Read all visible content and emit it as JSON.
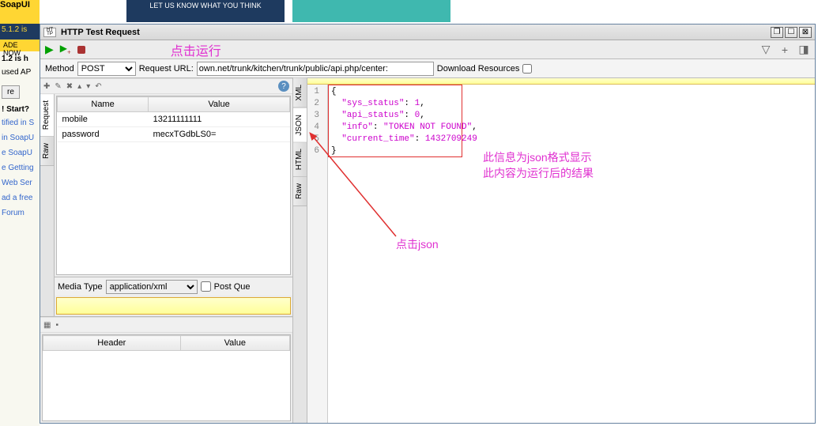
{
  "sidebar": {
    "logo": "SoapUI",
    "ver_banner": "5.1.2 is",
    "ade": "ADE NOW",
    "news_title": "1.2 is h",
    "news_text": "used AP",
    "btn": "re",
    "start": "! Start?",
    "links": [
      "tified in S",
      "in SoapU",
      "e SoapU",
      "e Getting",
      "Web Ser",
      "ad a free",
      "Forum"
    ]
  },
  "top_banner": "LET US KNOW WHAT YOU THINK",
  "window": {
    "title": "HTTP Test Request",
    "icon_top": "HT",
    "icon_bot": "TP"
  },
  "annotations": {
    "run": "点击运行",
    "json_info1": "此信息为json格式显示",
    "json_info2": "此内容为运行后的结果",
    "click_json": "点击json"
  },
  "urlbar": {
    "method_label": "Method",
    "method_value": "POST",
    "url_label": "Request URL:",
    "url_value": "own.net/trunk/kitchen/trunk/public/api.php/center:",
    "download_label": "Download Resources"
  },
  "request": {
    "tabs": [
      "Request",
      "Raw"
    ],
    "col_name": "Name",
    "col_value": "Value",
    "rows": [
      {
        "name": "mobile",
        "value": "13211111111"
      },
      {
        "name": "password",
        "value": "mecxTGdbLS0="
      }
    ],
    "media_label": "Media Type",
    "media_value": "application/xml",
    "post_query": "Post Que",
    "header_col1": "Header",
    "header_col2": "Value"
  },
  "response": {
    "tabs": [
      "XML",
      "JSON",
      "HTML",
      "Raw"
    ],
    "lines": [
      "1",
      "2",
      "3",
      "4",
      "5",
      "6"
    ],
    "json": {
      "l1": "{",
      "l2_k": "\"sys_status\"",
      "l2_v": "1",
      "l3_k": "\"api_status\"",
      "l3_v": "0",
      "l4_k": "\"info\"",
      "l4_v": "\"TOKEN NOT FOUND\"",
      "l5_k": "\"current_time\"",
      "l5_v": "1432709249",
      "l6": "}"
    }
  }
}
